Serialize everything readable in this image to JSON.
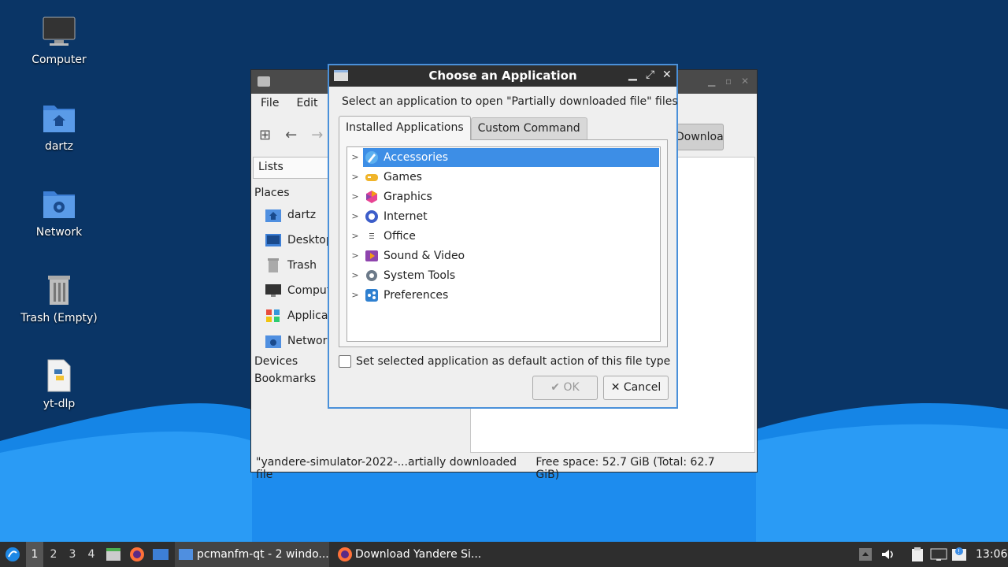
{
  "desktop": {
    "icons": [
      {
        "label": "Computer",
        "icon": "monitor-icon"
      },
      {
        "label": "dartz",
        "icon": "home-folder-icon"
      },
      {
        "label": "Network",
        "icon": "network-folder-icon"
      },
      {
        "label": "Trash (Empty)",
        "icon": "trash-icon"
      },
      {
        "label": "yt-dlp",
        "icon": "python-file-icon"
      }
    ]
  },
  "file_manager": {
    "menu": [
      "File",
      "Edit"
    ],
    "lists_label": "Lists",
    "places_header": "Places",
    "places": [
      "dartz",
      "Desktop",
      "Trash",
      "Computer",
      "Applications",
      "Network"
    ],
    "devices_header": "Devices",
    "bookmarks_header": "Bookmarks",
    "path_button": "Downloads",
    "status_left": "\"yandere-simulator-2022-...artially downloaded file",
    "status_right": "Free space: 52.7 GiB (Total: 62.7 GiB)"
  },
  "dialog": {
    "title": "Choose an Application",
    "prompt": "Select an application to open \"Partially downloaded file\" files",
    "tabs": [
      "Installed Applications",
      "Custom Command"
    ],
    "categories": [
      "Accessories",
      "Games",
      "Graphics",
      "Internet",
      "Office",
      "Sound & Video",
      "System Tools",
      "Preferences"
    ],
    "selected_category": "Accessories",
    "default_checkbox": "Set selected application as default action of this file type",
    "ok": "OK",
    "cancel": "Cancel"
  },
  "taskbar": {
    "desktops": [
      "1",
      "2",
      "3",
      "4"
    ],
    "active_desktop": "1",
    "tasks": [
      "pcmanfm-qt - 2 windo...",
      "Download Yandere Si..."
    ],
    "clock": "13:06"
  },
  "colors": {
    "desktop_bg": "#0a3566",
    "wave_light": "#1e8ef0",
    "selection": "#3d8ee6",
    "dialog_border": "#4a90d9"
  }
}
